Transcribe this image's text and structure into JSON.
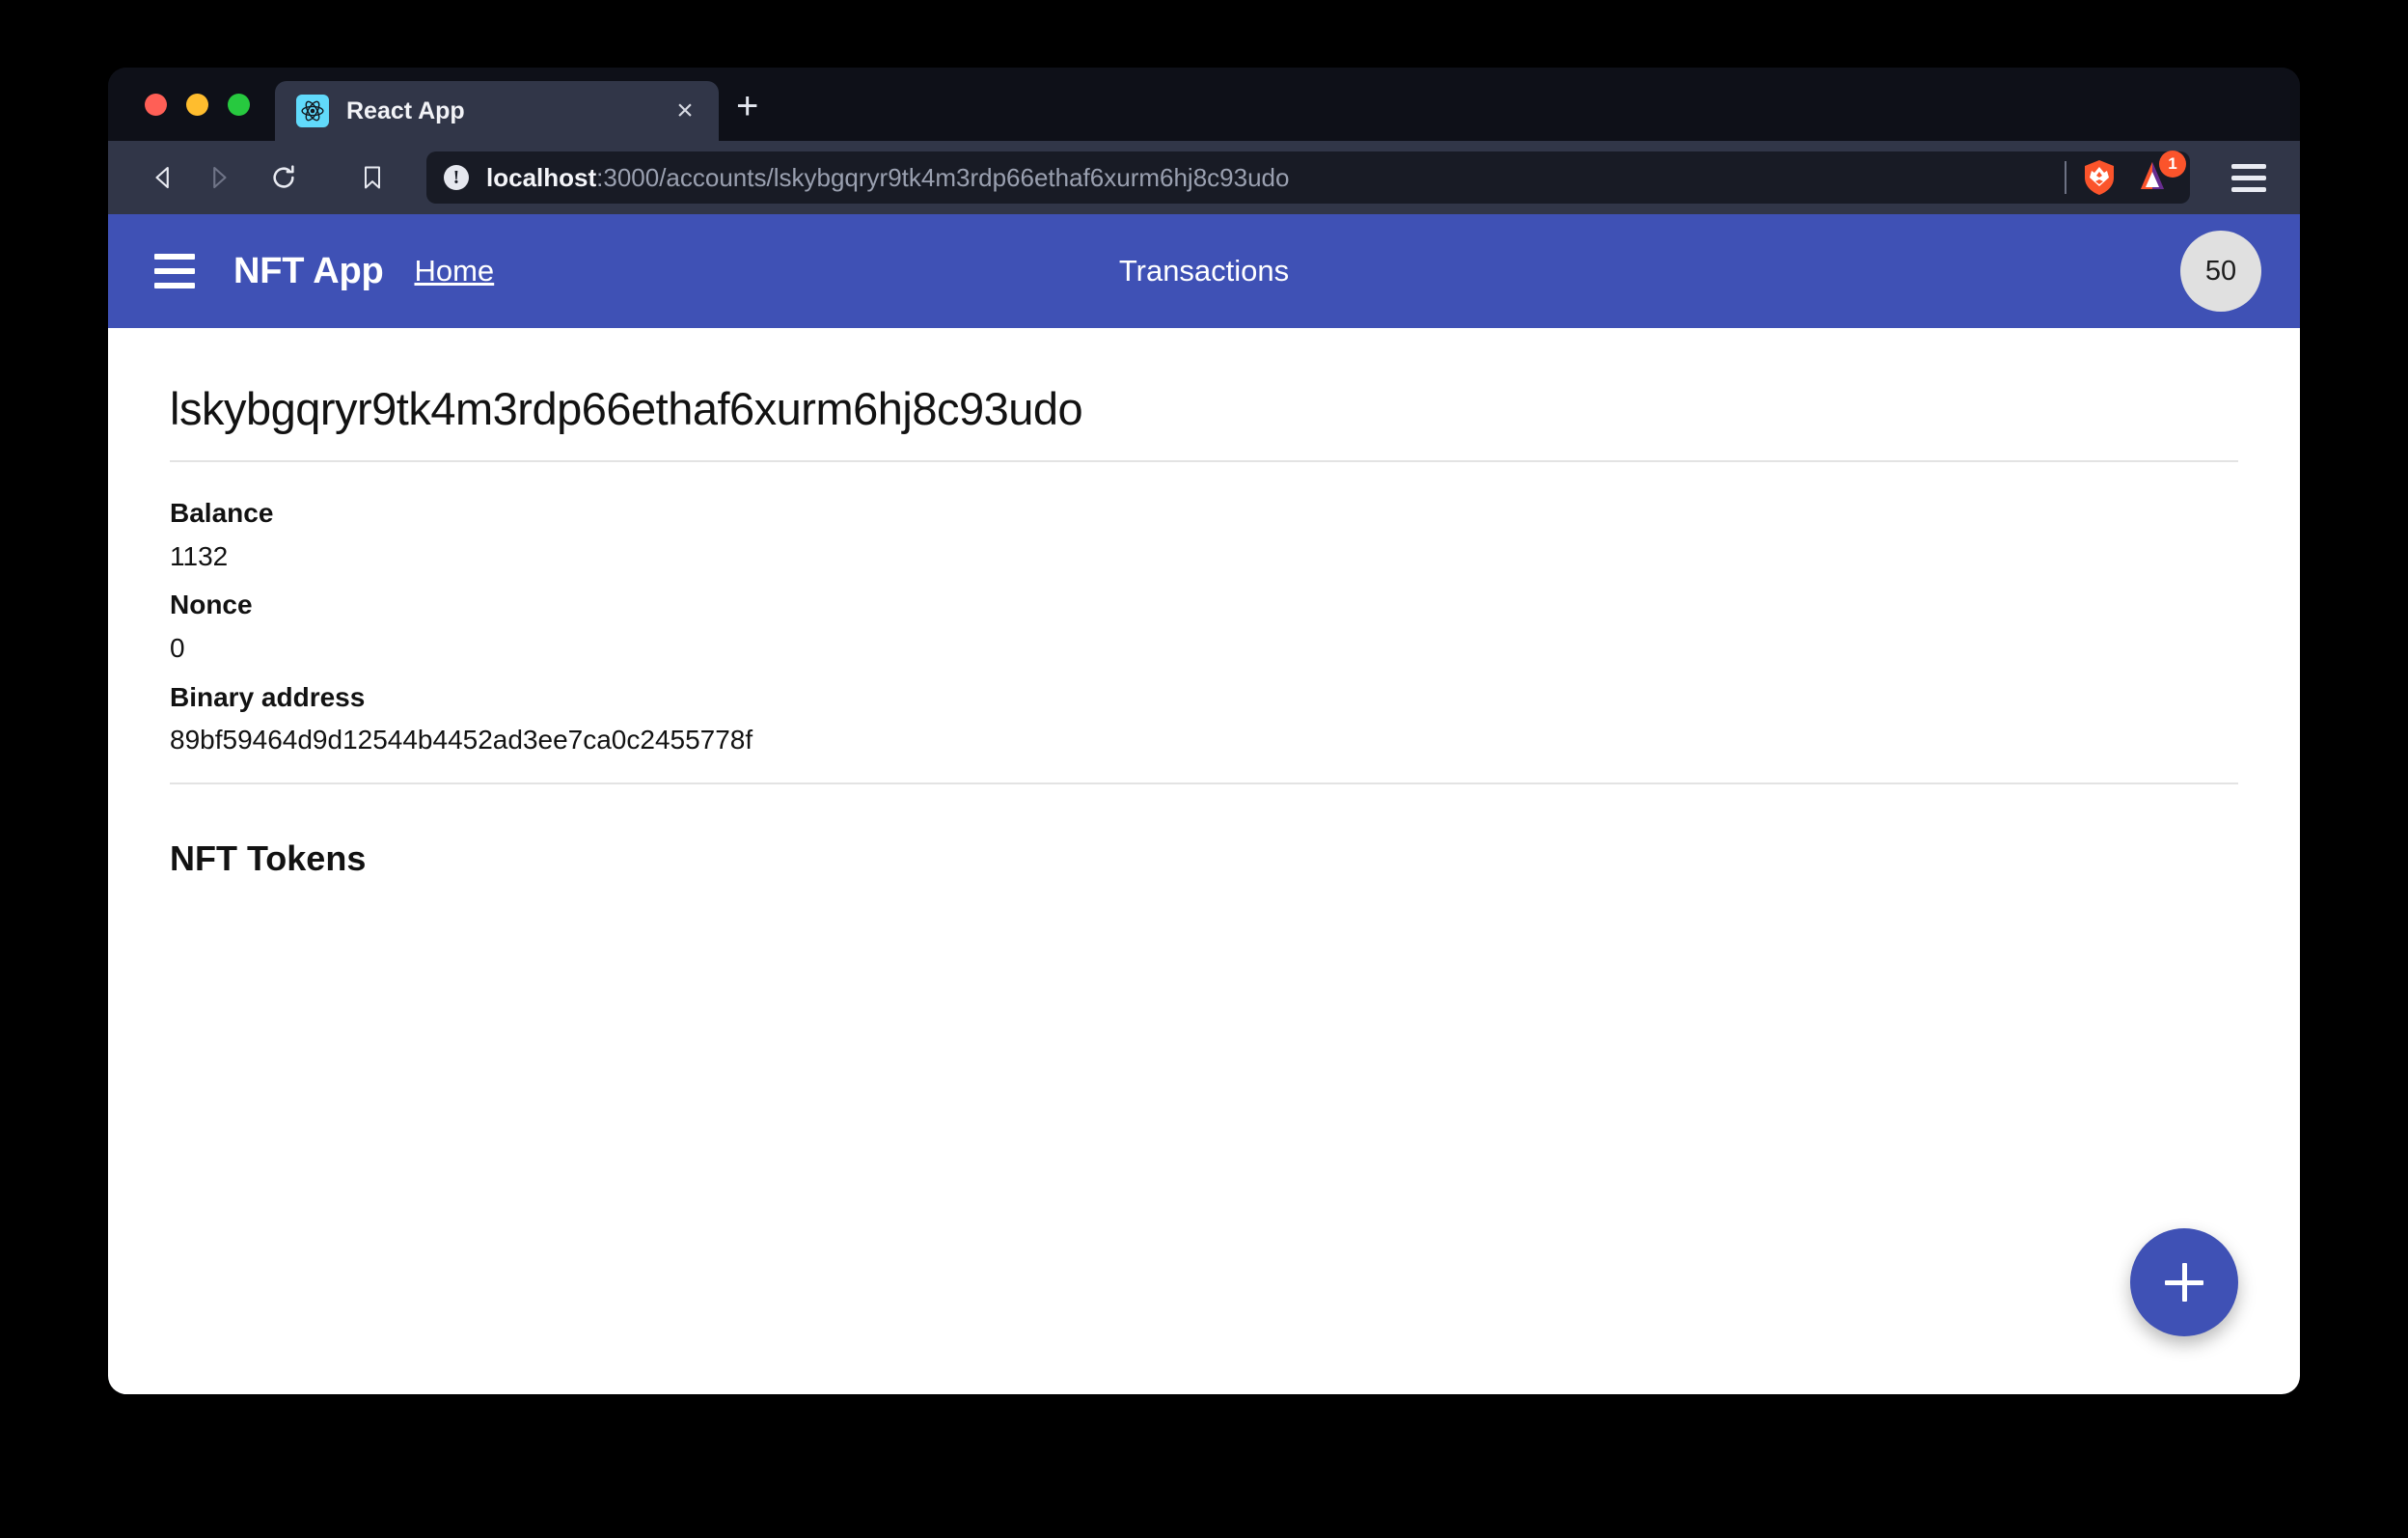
{
  "window": {
    "traffic_lights": [
      "close",
      "minimize",
      "maximize"
    ]
  },
  "browser": {
    "tab": {
      "title": "React App",
      "favicon_name": "react-logo-icon",
      "close_label": "×"
    },
    "new_tab_label": "+",
    "toolbar": {
      "back_label": "◁",
      "forward_label": "▷",
      "reload_label": "↻",
      "bookmark_label": "☆",
      "url_host": "localhost",
      "url_path": ":3000/accounts/lskybgqryr9tk4m3rdp66ethaf6xurm6hj8c93udo",
      "url_full": "localhost:3000/accounts/lskybgqryr9tk4m3rdp66ethaf6xurm6hj8c93udo",
      "info_icon_label": "!",
      "brave_shield_name": "brave-lion-shield-icon",
      "bat_icon_name": "brave-rewards-triangle-icon",
      "bat_badge_count": "1",
      "menu_label": "☰"
    }
  },
  "app": {
    "appbar": {
      "menu_icon_name": "hamburger-menu-icon",
      "brand": "NFT App",
      "home_link": "Home",
      "center_title": "Transactions",
      "avatar_label": "50",
      "background_color": "#3f51b5"
    },
    "page": {
      "account_address": "lskybgqryr9tk4m3rdp66ethaf6xurm6hj8c93udo",
      "details": [
        {
          "label": "Balance",
          "value": "1132"
        },
        {
          "label": "Nonce",
          "value": "0"
        },
        {
          "label": "Binary address",
          "value": "89bf59464d9d12544b4452ad3ee7ca0c2455778f"
        }
      ],
      "tokens_section_title": "NFT Tokens",
      "tokens": []
    },
    "fab": {
      "icon_name": "plus-icon",
      "label": "+",
      "color": "#3f51b5"
    }
  }
}
